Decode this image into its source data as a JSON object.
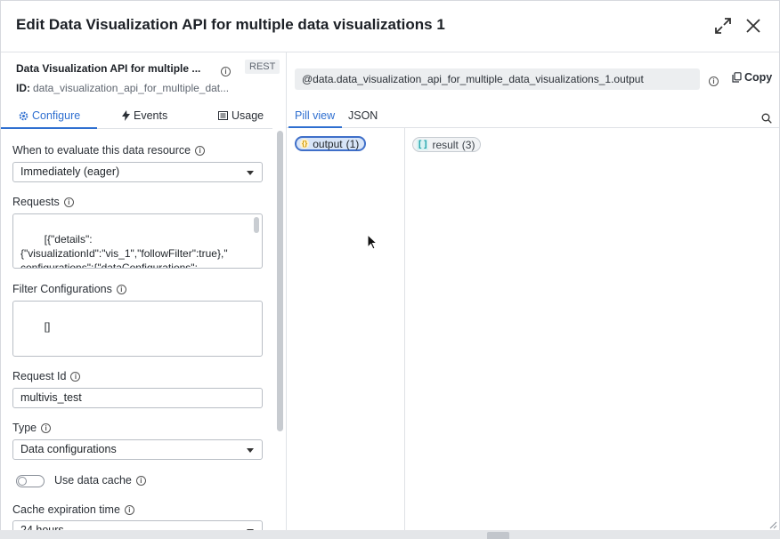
{
  "header": {
    "title": "Edit Data Visualization API for multiple data visualizations 1"
  },
  "resource": {
    "name": "Data Visualization API for multiple ...",
    "badge": "REST",
    "id_label": "ID:",
    "id": "data_visualization_api_for_multiple_dat..."
  },
  "left_tabs": [
    {
      "label": "Configure",
      "icon": "gear-icon"
    },
    {
      "label": "Events",
      "icon": "lightning-icon"
    },
    {
      "label": "Usage",
      "icon": "list-icon"
    }
  ],
  "form": {
    "evaluate_label": "When to evaluate this data resource",
    "evaluate_value": "Immediately (eager)",
    "requests_label": "Requests",
    "requests_value": "[{\"details\":\n{\"visualizationId\":\"vis_1\",\"followFilter\":true},\"\nconfigurations\":{\"dataConfigurations\":\n[{\"sourceType\":\"table\",\"dataCategory\":\"simp",
    "filter_label": "Filter Configurations",
    "filter_value": "[]",
    "request_id_label": "Request Id",
    "request_id_value": "multivis_test",
    "type_label": "Type",
    "type_value": "Data configurations",
    "cache_toggle_label": "Use data cache",
    "cache_expiration_label": "Cache expiration time",
    "cache_expiration_value": "24 hours"
  },
  "output": {
    "path": "@data.data_visualization_api_for_multiple_data_visualizations_1.output",
    "copy_label": "Copy",
    "view_tabs": [
      "Pill view",
      "JSON"
    ],
    "pills": [
      {
        "label": "output",
        "count": "(1)",
        "icon": "{}"
      },
      {
        "label": "result",
        "count": "(3)",
        "icon": "[ ]"
      }
    ]
  },
  "colors": {
    "accent": "#2f6fd0",
    "pill_selected_bg": "#d8e5f8",
    "pill_selected_border": "#3f6fc9"
  }
}
